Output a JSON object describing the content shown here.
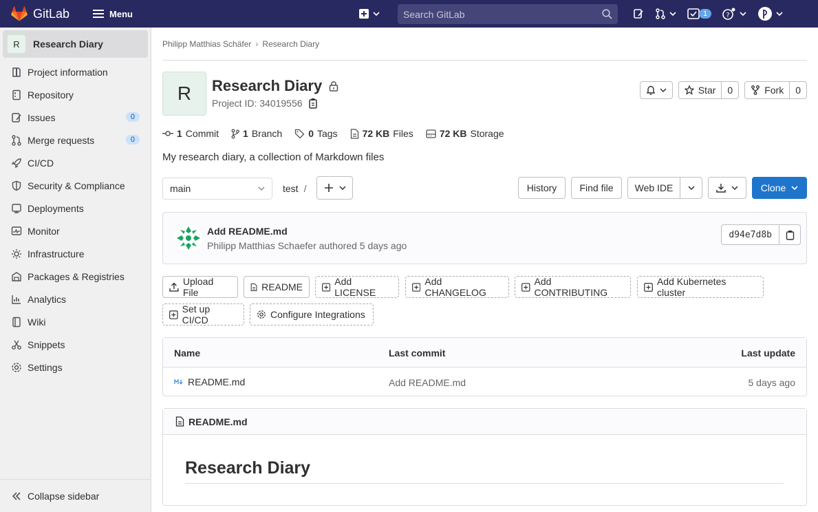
{
  "topbar": {
    "brand": "GitLab",
    "menu_label": "Menu",
    "search_placeholder": "Search GitLab",
    "todo_count": "1",
    "brand_color": "#fc6d26"
  },
  "sidebar": {
    "project_initial": "R",
    "project_name": "Research Diary",
    "items": [
      {
        "label": "Project information",
        "icon": "project-icon"
      },
      {
        "label": "Repository",
        "icon": "repository-icon"
      },
      {
        "label": "Issues",
        "icon": "issues-icon",
        "count": "0"
      },
      {
        "label": "Merge requests",
        "icon": "merge-request-icon",
        "count": "0"
      },
      {
        "label": "CI/CD",
        "icon": "rocket-icon"
      },
      {
        "label": "Security & Compliance",
        "icon": "shield-icon"
      },
      {
        "label": "Deployments",
        "icon": "deployments-icon"
      },
      {
        "label": "Monitor",
        "icon": "monitor-icon"
      },
      {
        "label": "Infrastructure",
        "icon": "cloud-gear-icon"
      },
      {
        "label": "Packages & Registries",
        "icon": "package-icon"
      },
      {
        "label": "Analytics",
        "icon": "chart-icon"
      },
      {
        "label": "Wiki",
        "icon": "book-icon"
      },
      {
        "label": "Snippets",
        "icon": "snippet-icon"
      },
      {
        "label": "Settings",
        "icon": "settings-icon"
      }
    ],
    "collapse_label": "Collapse sidebar"
  },
  "breadcrumb": {
    "owner": "Philipp Matthias Schäfer",
    "project": "Research Diary"
  },
  "project": {
    "initial": "R",
    "title": "Research Diary",
    "project_id_label": "Project ID: 34019556",
    "star_label": "Star",
    "star_count": "0",
    "fork_label": "Fork",
    "fork_count": "0",
    "stats": {
      "commits_num": "1",
      "commits_label": "Commit",
      "branches_num": "1",
      "branches_label": "Branch",
      "tags_num": "0",
      "tags_label": "Tags",
      "files_num": "72 KB",
      "files_label": "Files",
      "storage_num": "72 KB",
      "storage_label": "Storage"
    },
    "description": "My research diary, a collection of Markdown files"
  },
  "toolbar": {
    "branch": "main",
    "path_root": "test",
    "path_sep": "/",
    "history": "History",
    "find_file": "Find file",
    "web_ide": "Web IDE",
    "clone": "Clone"
  },
  "commit": {
    "title": "Add README.md",
    "meta": "Philipp Matthias Schaefer authored 5 days ago",
    "sha": "d94e7d8b"
  },
  "quick_actions": {
    "upload": "Upload File",
    "readme": "README",
    "license": "Add LICENSE",
    "changelog": "Add CHANGELOG",
    "contributing": "Add CONTRIBUTING",
    "kubernetes": "Add Kubernetes cluster",
    "cicd": "Set up CI/CD",
    "integrations": "Configure Integrations"
  },
  "files_table": {
    "headers": {
      "name": "Name",
      "last_commit": "Last commit",
      "last_update": "Last update"
    },
    "rows": [
      {
        "name": "README.md",
        "last_commit": "Add README.md",
        "last_update": "5 days ago"
      }
    ]
  },
  "readme": {
    "file_name": "README.md",
    "heading": "Research Diary"
  }
}
